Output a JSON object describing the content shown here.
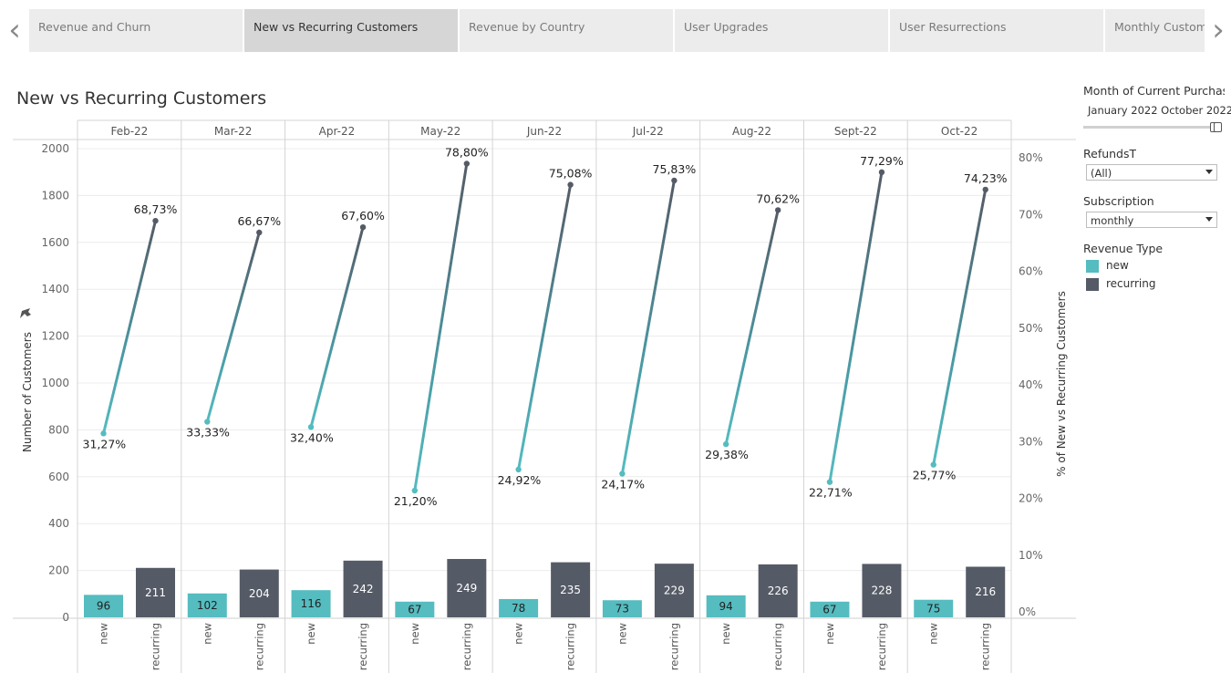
{
  "tabs": [
    {
      "label": "Revenue and Churn",
      "active": false
    },
    {
      "label": "New vs Recurring Customers",
      "active": true
    },
    {
      "label": "Revenue by Country",
      "active": false
    },
    {
      "label": "User Upgrades",
      "active": false
    },
    {
      "label": "User Resurrections",
      "active": false
    },
    {
      "label": "Monthly Customers",
      "active": false
    }
  ],
  "nav": {
    "prev_glyph": "‹",
    "next_glyph": "›"
  },
  "page_title": "New vs Recurring Customers",
  "filters": {
    "month_label": "Month of Current Purchas..",
    "month_range": "January 2022 October 2022",
    "month_range_fraction": [
      0.98,
      1.0
    ],
    "refunds_label": "RefundsT",
    "refunds_value": "(All)",
    "subscription_label": "Subscription",
    "subscription_value": "monthly"
  },
  "legend": {
    "title": "Revenue Type",
    "items": [
      {
        "label": "new",
        "color": "#55bcc0"
      },
      {
        "label": "recurring",
        "color": "#555b66"
      }
    ]
  },
  "colors": {
    "new": "#55bcc0",
    "recurring": "#555b66",
    "grid": "#ececec",
    "divider": "#d4d4d4"
  },
  "icons": {
    "pin": "pin-icon"
  },
  "chart_data": {
    "type": "bar",
    "title": "New vs Recurring Customers",
    "categories": [
      "Feb-22",
      "Mar-22",
      "Apr-22",
      "May-22",
      "Jun-22",
      "Jul-22",
      "Aug-22",
      "Sept-22",
      "Oct-22"
    ],
    "sub_categories": [
      "new",
      "recurring"
    ],
    "series": [
      {
        "name": "new",
        "values": [
          96,
          102,
          116,
          67,
          78,
          73,
          94,
          67,
          75
        ]
      },
      {
        "name": "recurring",
        "values": [
          211,
          204,
          242,
          249,
          235,
          229,
          226,
          228,
          216
        ]
      }
    ],
    "pct_series": [
      {
        "name": "new",
        "values": [
          31.27,
          33.33,
          32.4,
          21.2,
          24.92,
          24.17,
          29.38,
          22.71,
          25.77
        ],
        "labels": [
          "31,27%",
          "33,33%",
          "32,40%",
          "21,20%",
          "24,92%",
          "24,17%",
          "29,38%",
          "22,71%",
          "25,77%"
        ]
      },
      {
        "name": "recurring",
        "values": [
          68.73,
          66.67,
          67.6,
          78.8,
          75.08,
          75.83,
          70.62,
          77.29,
          74.23
        ],
        "labels": [
          "68,73%",
          "66,67%",
          "67,60%",
          "78,80%",
          "75,08%",
          "75,83%",
          "70,62%",
          "77,29%",
          "74,23%"
        ]
      }
    ],
    "ylabel": "Number of Customers",
    "y2label": "% of New vs Recurring Customers",
    "ylim": [
      0,
      2000
    ],
    "yticks": [
      0,
      200,
      400,
      600,
      800,
      1000,
      1200,
      1400,
      1600,
      1800,
      2000
    ],
    "y2lim": [
      0,
      80
    ],
    "y2ticks": [
      0,
      10,
      20,
      30,
      40,
      50,
      60,
      70,
      80
    ],
    "y2tick_labels": [
      "0%",
      "10%",
      "20%",
      "30%",
      "40%",
      "50%",
      "60%",
      "70%",
      "80%"
    ],
    "grid": true,
    "legend_position": "right"
  }
}
